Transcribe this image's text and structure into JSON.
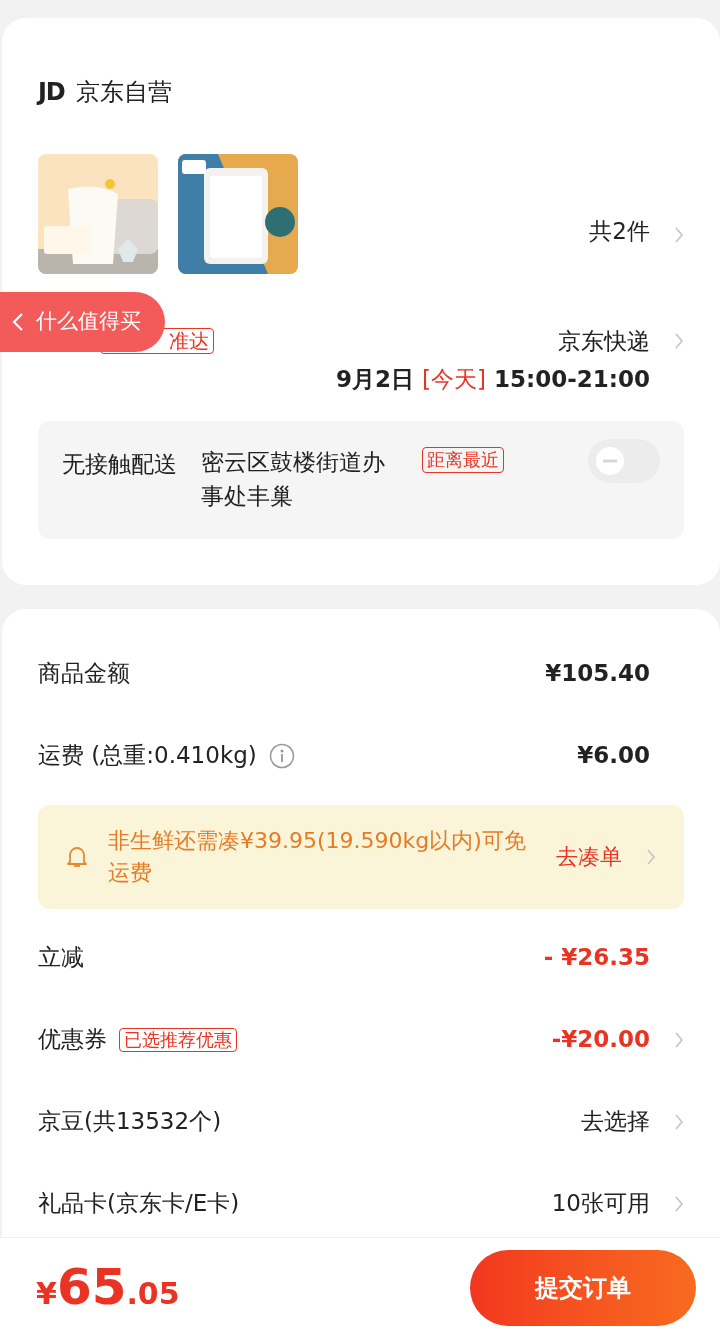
{
  "store": {
    "logo": "JD",
    "name": "京东自营"
  },
  "item_count": "共2件",
  "delivery": {
    "tag": "准达",
    "carrier": "京东快递",
    "date": "9月2日",
    "day_tag": "[今天]",
    "time": "15:00-21:00"
  },
  "contactless": {
    "label": "无接触配送",
    "station": "密云区鼓楼街道办事处丰巢",
    "station_tag": "距离最近",
    "on": false
  },
  "floating_button": {
    "label": "什么值得买"
  },
  "price_rows": [
    {
      "kind": "plain",
      "label": "商品金额",
      "value": "¥105.40",
      "emphasis": false,
      "bold": true,
      "chevron": false
    },
    {
      "kind": "info",
      "label": "运费 (总重:0.410kg)",
      "value": "¥6.00",
      "emphasis": false,
      "bold": true,
      "chevron": false
    },
    {
      "kind": "notice",
      "text": "非生鲜还需凑¥39.95(19.590kg以内)可免运费",
      "action": "去凑单"
    },
    {
      "kind": "plain",
      "label": "立减",
      "value": "- ¥26.35",
      "emphasis": true,
      "bold": true,
      "chevron": false
    },
    {
      "kind": "tagged",
      "label": "优惠券",
      "tag": "已选推荐优惠",
      "value": "-¥20.00",
      "emphasis": true,
      "bold": true,
      "chevron": true
    },
    {
      "kind": "plain",
      "label": "京豆(共13532个)",
      "value": "去选择",
      "emphasis": false,
      "bold": false,
      "chevron": true
    },
    {
      "kind": "plain",
      "label": "礼品卡(京东卡/E卡)",
      "value": "10张可用",
      "emphasis": false,
      "bold": false,
      "chevron": true
    }
  ],
  "footer": {
    "currency": "¥",
    "integer": "65",
    "decimal": ".05",
    "submit": "提交订单"
  }
}
